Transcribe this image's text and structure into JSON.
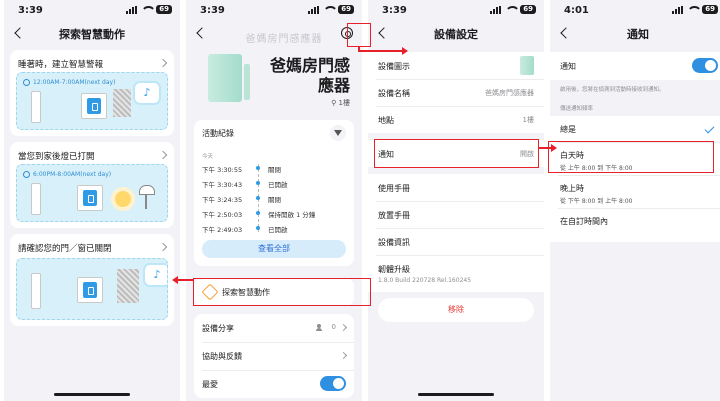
{
  "phone1": {
    "time": "3:39",
    "battery": "69",
    "title": "探索智慧動作",
    "cards": [
      {
        "title": "睡著時，建立智慧警報",
        "time_range": "12:00AM-7:00AM(next day)"
      },
      {
        "title": "當您到家後燈已打開",
        "time_range": "6:00PM-8:00AM(next day)"
      },
      {
        "title": "請確認您的門／窗已關閉"
      }
    ]
  },
  "phone2": {
    "time": "3:39",
    "battery": "69",
    "ghost_title": "爸媽房門感應器",
    "device_name": "爸媽房門感應器",
    "floor": "1樓",
    "activity_title": "活動紀錄",
    "today_label": "今天",
    "activity": [
      {
        "time": "下午 3:30:55",
        "event": "關閉"
      },
      {
        "time": "下午 3:30:43",
        "event": "已開啟"
      },
      {
        "time": "下午 3:24:35",
        "event": "關閉"
      },
      {
        "time": "下午 2:50:03",
        "event": "保持開啟 1 分鐘"
      },
      {
        "time": "下午 2:49:03",
        "event": "已開啟"
      }
    ],
    "view_all": "查看全部",
    "explore": "探索智慧動作",
    "share_label": "設備分享",
    "share_count": "0",
    "feedback_label": "協助與反饋",
    "favorite_label": "最愛"
  },
  "phone3": {
    "time": "3:39",
    "battery": "69",
    "title": "設備設定",
    "icon_label": "設備圖示",
    "name_label": "設備名稱",
    "name_value": "爸媽房門感應器",
    "location_label": "地點",
    "location_value": "1樓",
    "notif_label": "通知",
    "notif_value": "開啟",
    "manual_label": "使用手冊",
    "place_label": "放置手冊",
    "info_label": "設備資訊",
    "firmware_label": "韌體升級",
    "firmware_version": "1.8.0 Build 220728 Rel.160245",
    "remove": "移除"
  },
  "phone4": {
    "time": "4:01",
    "battery": "69",
    "title": "通知",
    "notif_label": "通知",
    "description": "啟用後，您將在偵測到活動時接收到通知。",
    "section": "傳送通知頻率",
    "options": [
      {
        "label": "總是"
      },
      {
        "label": "白天時",
        "sub": "從 上午 8:00 到 下午 8:00"
      },
      {
        "label": "晚上時",
        "sub": "從 下午 8:00 到 上午 8:00"
      },
      {
        "label": "在自訂時間內"
      }
    ]
  },
  "colors": {
    "accent": "#2f8fe0",
    "annotation": "#e8202a",
    "danger": "#e53935"
  }
}
